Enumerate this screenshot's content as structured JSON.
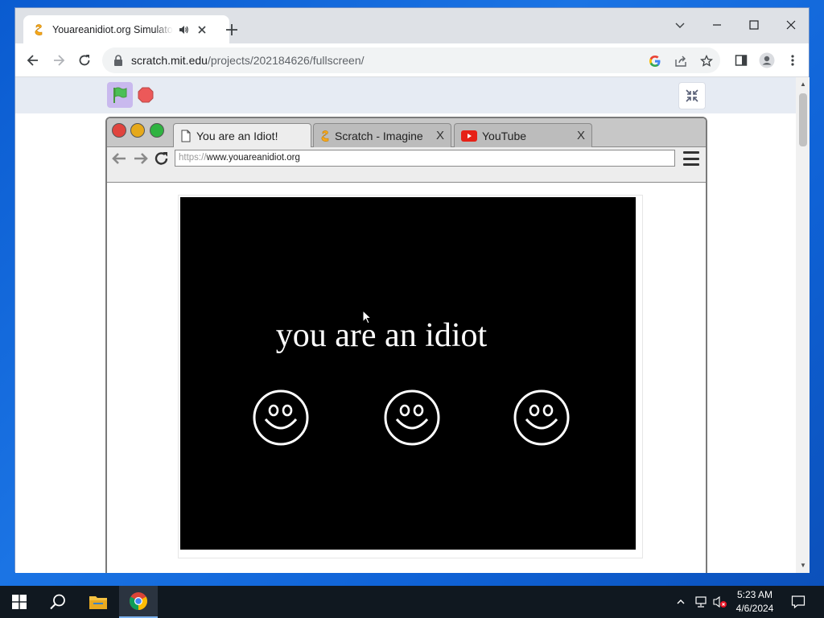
{
  "browser": {
    "tab": {
      "title": "Youareanidiot.org Simulator"
    },
    "address": {
      "host": "scratch.mit.edu",
      "path": "/projects/202184626/fullscreen/"
    }
  },
  "fake_browser": {
    "tabs": [
      {
        "label": "You are an Idiot!"
      },
      {
        "label": "Scratch - Imagine"
      },
      {
        "label": "YouTube"
      }
    ],
    "close_glyph": "X",
    "url_scheme": "https://",
    "url_host": "www.youareanidiot.org"
  },
  "page": {
    "message": "you are an idiot"
  },
  "taskbar": {
    "time": "5:23 AM",
    "date": "4/6/2024"
  },
  "colors": {
    "desktop": "#0f62d6",
    "traffic_red": "#e0443e",
    "traffic_yellow": "#e6a91b",
    "traffic_green": "#2fb341",
    "scratch_orange": "#f7a81b"
  }
}
